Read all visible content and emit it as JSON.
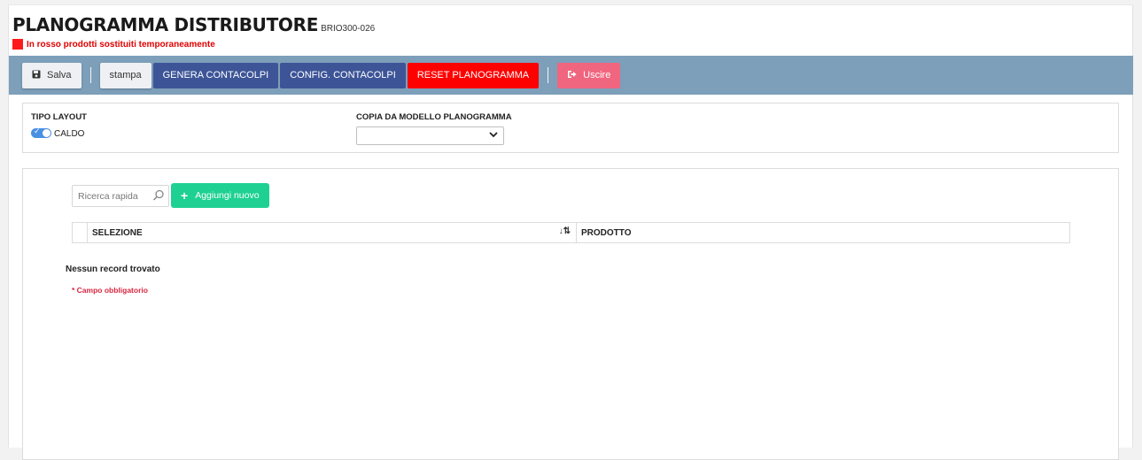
{
  "header": {
    "title": "PLANOGRAMMA DISTRIBUTORE",
    "code": "BRIO300-026",
    "legend_text": "In rosso prodotti sostituiti temporaneamente",
    "legend_color": "#ff1a1a"
  },
  "toolbar": {
    "background": "#7d9fba",
    "save_label": "Salva",
    "print_label": "stampa",
    "genera_label": "GENERA CONTACOLPI",
    "config_label": "CONFIG. CONTACOLPI",
    "reset_label": "RESET PLANOGRAMMA",
    "exit_label": "Uscire",
    "icons": {
      "save": "floppy-disk-icon",
      "exit": "sign-out-icon"
    }
  },
  "layout_panel": {
    "tipo_layout_label": "TIPO LAYOUT",
    "toggle_label": "CALDO",
    "toggle_on": true,
    "copia_label": "COPIA DA MODELLO PLANOGRAMMA",
    "copia_selected": ""
  },
  "list_panel": {
    "search_placeholder": "Ricerca rapida",
    "add_label": "Aggiungi nuovo",
    "columns": [
      "SELEZIONE",
      "PRODOTTO"
    ],
    "empty_text": "Nessun record trovato",
    "required_note": "* Campo obbligatorio"
  },
  "colors": {
    "blue_button": "#3d5597",
    "red_button": "#ff0000",
    "pink_button": "#f0667f",
    "green_button": "#1ed192"
  }
}
